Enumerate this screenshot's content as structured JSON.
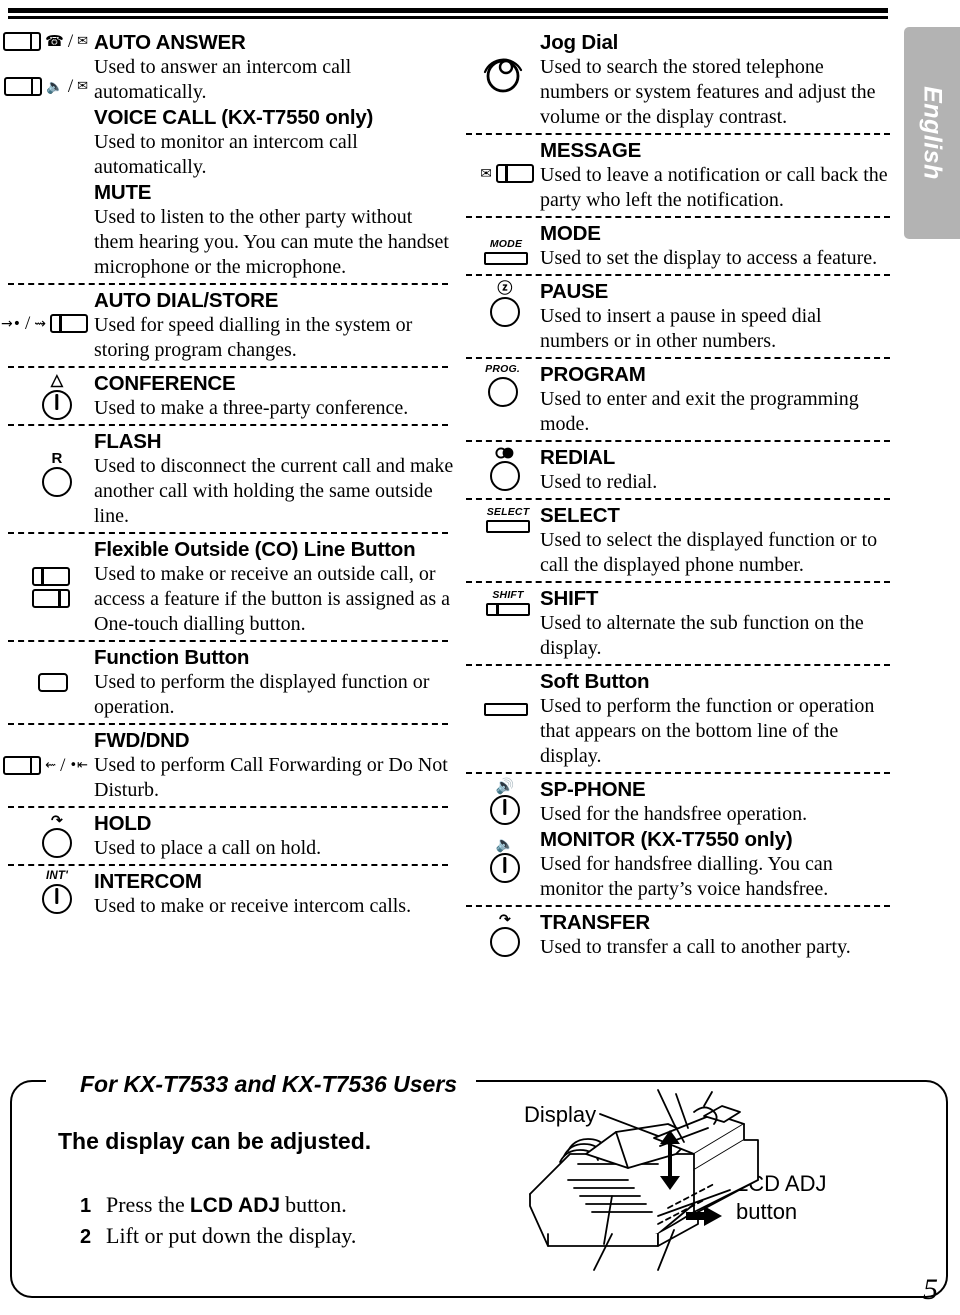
{
  "page": {
    "language_tab": "English",
    "page_number": "5"
  },
  "left_column": [
    {
      "icon": "lamp-button-ring-and-envelope",
      "terms": [
        {
          "term": "AUTO ANSWER",
          "desc": "Used to answer an intercom call automatically."
        },
        {
          "term": "VOICE CALL (KX-T7550 only)",
          "desc": "Used to monitor an intercom call automatically."
        },
        {
          "term": "MUTE",
          "desc": "Used to listen to the other party without them hearing you. You can mute the handset microphone or the microphone."
        }
      ]
    },
    {
      "icon": "arrow-dot-and-lamp-button",
      "terms": [
        {
          "term": "AUTO DIAL/STORE",
          "desc": "Used for speed dialling in the system or storing program changes."
        }
      ]
    },
    {
      "icon": "conference-key",
      "terms": [
        {
          "term": "CONFERENCE",
          "desc": "Used to make a three-party conference."
        }
      ]
    },
    {
      "icon": "flash-r-key",
      "terms": [
        {
          "term": "FLASH",
          "desc": "Used to disconnect the current call and make another call with holding the same outside line."
        }
      ]
    },
    {
      "icon": "two-stacked-lamp-buttons",
      "terms": [
        {
          "term": "Flexible Outside (CO) Line Button",
          "desc": "Used to make or receive an outside call, or access a feature if the button is assigned as a One-touch dialling button."
        }
      ]
    },
    {
      "icon": "plain-button",
      "terms": [
        {
          "term": "Function Button",
          "desc": "Used to perform the displayed function or operation."
        }
      ]
    },
    {
      "icon": "lamp-button-fwd-dnd",
      "terms": [
        {
          "term": "FWD/DND",
          "desc": "Used to perform Call Forwarding or Do Not Disturb."
        }
      ]
    },
    {
      "icon": "hold-key",
      "terms": [
        {
          "term": "HOLD",
          "desc": "Used to place a call on hold."
        }
      ]
    },
    {
      "icon": "intercom-key",
      "terms": [
        {
          "term": "INTERCOM",
          "desc": "Used to make or receive intercom calls."
        }
      ]
    }
  ],
  "right_column": [
    {
      "icon": "jog-dial",
      "terms": [
        {
          "term": "Jog Dial",
          "desc": "Used to search the stored telephone numbers or system features and adjust the volume or the display contrast."
        }
      ]
    },
    {
      "icon": "envelope-and-lamp-button",
      "terms": [
        {
          "term": "MESSAGE",
          "desc": "Used to leave a notification or call back the party who left the notification."
        }
      ]
    },
    {
      "icon": "mode-flat-button",
      "icon_caption": "MODE",
      "terms": [
        {
          "term": "MODE",
          "desc": "Used to set the display to access a feature."
        }
      ]
    },
    {
      "icon": "pause-key",
      "terms": [
        {
          "term": "PAUSE",
          "desc": "Used to insert a pause in speed dial numbers or in other numbers."
        }
      ]
    },
    {
      "icon": "program-key",
      "icon_caption": "PROG.",
      "terms": [
        {
          "term": "PROGRAM",
          "desc": "Used to enter and exit the programming mode."
        }
      ]
    },
    {
      "icon": "redial-key",
      "terms": [
        {
          "term": "REDIAL",
          "desc": "Used to redial."
        }
      ]
    },
    {
      "icon": "select-flat-button",
      "icon_caption": "SELECT",
      "terms": [
        {
          "term": "SELECT",
          "desc": "Used to select the displayed function or to call the displayed phone number."
        }
      ]
    },
    {
      "icon": "shift-flat-button",
      "icon_caption": "SHIFT",
      "terms": [
        {
          "term": "SHIFT",
          "desc": "Used to alternate the sub function on the display."
        }
      ]
    },
    {
      "icon": "soft-flat-button",
      "terms": [
        {
          "term": "Soft Button",
          "desc": "Used to perform the function or operation that appears on the bottom line of the display."
        }
      ]
    },
    {
      "icon": "speaker-keys",
      "terms": [
        {
          "term": "SP-PHONE",
          "desc": "Used for the handsfree operation."
        },
        {
          "term": "MONITOR (KX-T7550 only)",
          "desc": "Used for handsfree dialling. You can monitor the party’s voice handsfree."
        }
      ]
    },
    {
      "icon": "transfer-key",
      "terms": [
        {
          "term": "TRANSFER",
          "desc": "Used to transfer a call to another party."
        }
      ]
    }
  ],
  "bottom_box": {
    "title": "For KX-T7533 and KX-T7536 Users",
    "heading": "The display can be adjusted.",
    "steps": [
      {
        "num": "1",
        "pre": "Press the",
        "bold": "LCD ADJ",
        "post": "button."
      },
      {
        "num": "2",
        "pre": "Lift or put down the display.",
        "bold": "",
        "post": ""
      }
    ],
    "illustration": {
      "label_display": "Display",
      "label_lcd_line1": "LCD ADJ",
      "label_lcd_line2": "button"
    }
  }
}
